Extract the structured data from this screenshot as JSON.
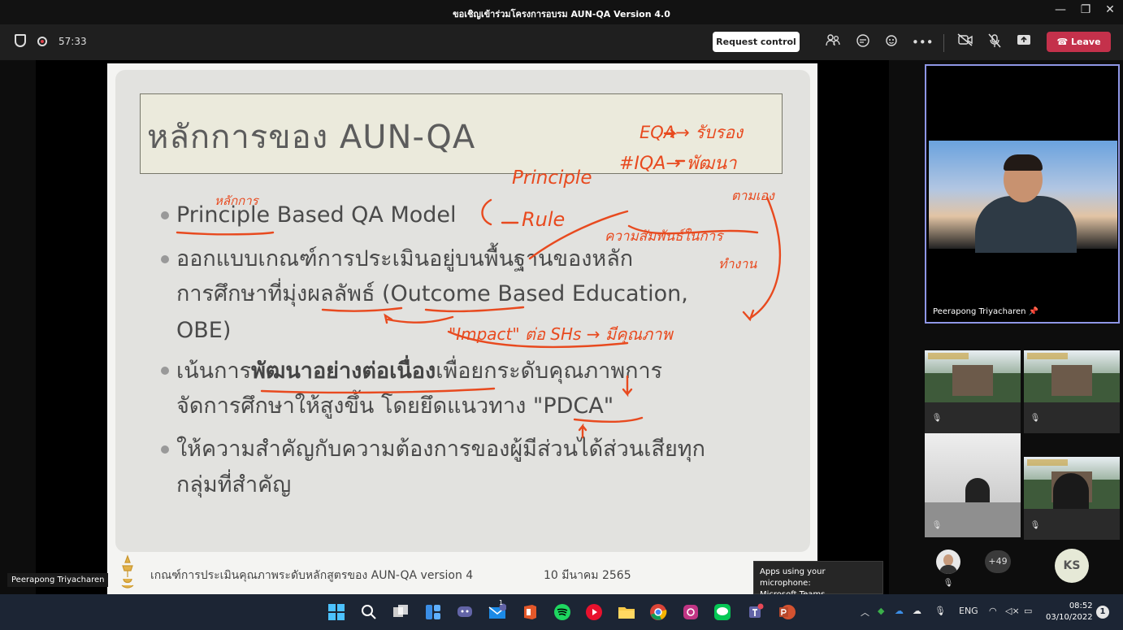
{
  "window": {
    "title": "ขอเชิญเข้าร่วมโครงการอบรม AUN-QA Version 4.0",
    "minimize": "—",
    "maximize": "❐",
    "close": "✕"
  },
  "toolbar": {
    "timer": "57:33",
    "request_control": "Request control",
    "more": "•••",
    "leave": "Leave"
  },
  "slide": {
    "title": "หลักการของ AUN-QA",
    "bullets": [
      {
        "parts": [
          "Principle Based QA Model"
        ]
      },
      {
        "lines": [
          "ออกแบบเกณฑ์การประเมินอยู่บนพื้นฐานของหลัก",
          "การศึกษาที่มุ่งผลลัพธ์ (Outcome Based Education,",
          "OBE)"
        ]
      },
      {
        "line1_pre": "เน้นการ",
        "line1_bold": "พัฒนาอย่างต่อเนื่อง",
        "line1_post": "เพื่อยกระดับคุณภาพการ",
        "line2": "จัดการศึกษาให้สูงขึ้น โดยยึดแนวทาง \"PDCA\""
      },
      {
        "lines": [
          "ให้ความสำคัญกับความต้องการของผู้มีส่วนได้ส่วนเสียทุก",
          "กลุ่มที่สำคัญ"
        ]
      }
    ],
    "footer_text": "เกณฑ์การประเมินคุณภาพระดับหลักสูตรของ AUN-QA version 4",
    "footer_date": "10 มีนาคม 2565"
  },
  "annotations": {
    "eqa": "EQA→ รับรอง",
    "iqa": "#IQA→ พัฒนา",
    "principle": "Principle",
    "rule": "Rule",
    "thai_note": "หลักการ",
    "stakeholder_note": "ความสัมพันธ์ในการ",
    "part_note": "ทำงาน",
    "follow_note": "ตามเอง",
    "impact": "\"Impact\" ต่อ SHs → มีคุณภาพ"
  },
  "speaker_label": "Peerapong Triyacharen",
  "main_video": {
    "name": "Peerapong Triyacharen"
  },
  "participants": {
    "more_count": "+49",
    "initials": "KS"
  },
  "tooltip": {
    "line1": "Apps using your microphone:",
    "line2": "Microsoft Teams"
  },
  "taskbar": {
    "lang": "ENG",
    "time": "08:52",
    "date": "03/10/2022",
    "notif_count": "1",
    "chat_badge": "1"
  }
}
